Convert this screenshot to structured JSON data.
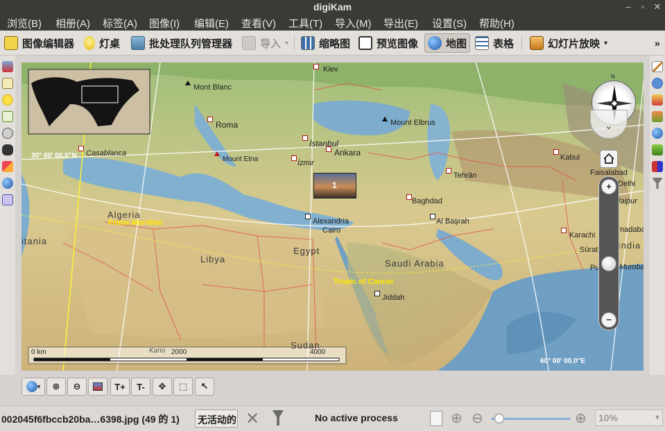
{
  "window": {
    "title": "digiKam"
  },
  "menu": [
    {
      "label": "浏览(B)"
    },
    {
      "label": "相册(A)"
    },
    {
      "label": "标签(A)"
    },
    {
      "label": "图像(I)"
    },
    {
      "label": "编辑(E)"
    },
    {
      "label": "查看(V)"
    },
    {
      "label": "工具(T)"
    },
    {
      "label": "导入(M)"
    },
    {
      "label": "导出(E)"
    },
    {
      "label": "设置(S)"
    },
    {
      "label": "帮助(H)"
    }
  ],
  "toolbar": {
    "image_editor": "图像编辑器",
    "light_table": "灯桌",
    "batch_queue": "批处理队列管理器",
    "import": "导入",
    "thumbnails": "缩略图",
    "preview": "预览图像",
    "map": "地图",
    "table": "表格",
    "slideshow": "幻灯片放映",
    "overflow": "»"
  },
  "map": {
    "labels": {
      "kiev": "Kiev",
      "mont_blanc": "Mont Blanc",
      "roma": "Roma",
      "mount_elbrus": "Mount Elbrus",
      "istanbul": "İstanbul",
      "ankara": "Ankara",
      "izmir": "İzmir",
      "mount_etna": "Mount Etna",
      "casablanca": "Casablanca",
      "tehran": "Tehrān",
      "kabul": "Kabul",
      "faisalabad": "Faisalabad",
      "delhi": "Delhi",
      "jaipur": "Jaipur",
      "baghdad": "Baghdad",
      "al_basrah": "Al Başrah",
      "alexandria": "Alexandria",
      "cairo": "Cairo",
      "algeria": "Algeria",
      "prime_meridian": "Prime Meridian",
      "mauritania": "itania",
      "libya": "Libya",
      "egypt": "Egypt",
      "saudi_arabia": "Saudi Arabia",
      "tropic": "Tropic of Cancer",
      "jiddah": "Jiddah",
      "sudan": "Sudan",
      "kano": "Kano",
      "karachi": "Karachi",
      "surat": "Sūrat",
      "pune": "Pu",
      "mumbai": "Mumbai",
      "ahmadabad": "madabad",
      "india": "India",
      "lat_label": "30° 00' 00.0\"N",
      "lon_label": "60° 00' 00.0\"E"
    },
    "photo_cluster_count": "1",
    "scale": {
      "start": "0 km",
      "mid": "2000",
      "end": "4000"
    },
    "zoom_level_fraction": 0.4
  },
  "maptoolbar": {
    "text_plus": "T+",
    "text_minus": "T-"
  },
  "status": {
    "filename": "002045f6fbccb20ba…6398.jpg (49 的 1)",
    "no_activity": "无活动的",
    "process": "No active process",
    "zoom": "10%"
  }
}
